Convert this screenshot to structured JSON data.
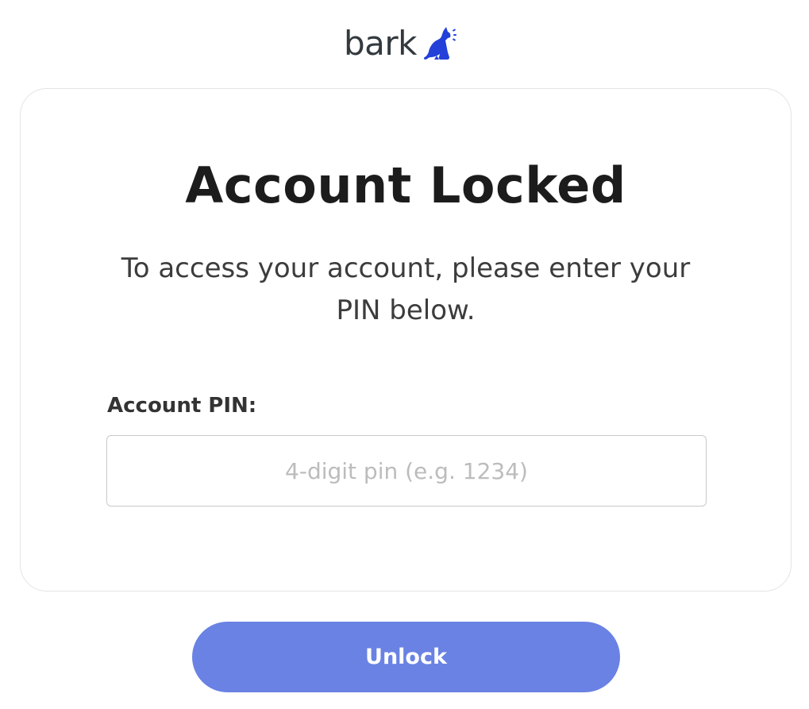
{
  "logo": {
    "text": "bark",
    "icon": "dog-barking-icon",
    "icon_color": "#2340d8",
    "text_color": "#333a3f"
  },
  "card": {
    "title": "Account Locked",
    "subtitle": "To access your account, please enter your PIN below.",
    "field_label": "Account PIN:",
    "pin_input": {
      "placeholder": "4-digit pin (e.g. 1234)",
      "value": ""
    }
  },
  "actions": {
    "unlock_label": "Unlock",
    "unlock_color": "#6a82e3"
  }
}
